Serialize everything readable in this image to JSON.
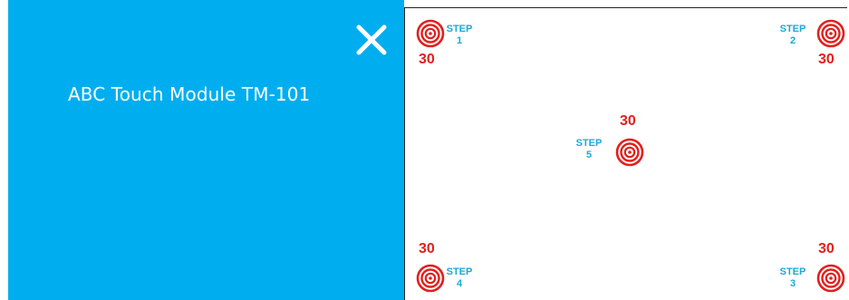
{
  "window": {
    "title": "ABC Touch Module TM-101",
    "close_icon": "close-icon"
  },
  "colors": {
    "panel_blue": "#00aeef",
    "step_text": "#1aa9d8",
    "target_red": "#e2201d"
  },
  "targets": [
    {
      "step_word": "STEP",
      "step_number": "1",
      "count": "30"
    },
    {
      "step_word": "STEP",
      "step_number": "2",
      "count": "30"
    },
    {
      "step_word": "STEP",
      "step_number": "3",
      "count": "30"
    },
    {
      "step_word": "STEP",
      "step_number": "4",
      "count": "30"
    },
    {
      "step_word": "STEP",
      "step_number": "5",
      "count": "30"
    }
  ]
}
